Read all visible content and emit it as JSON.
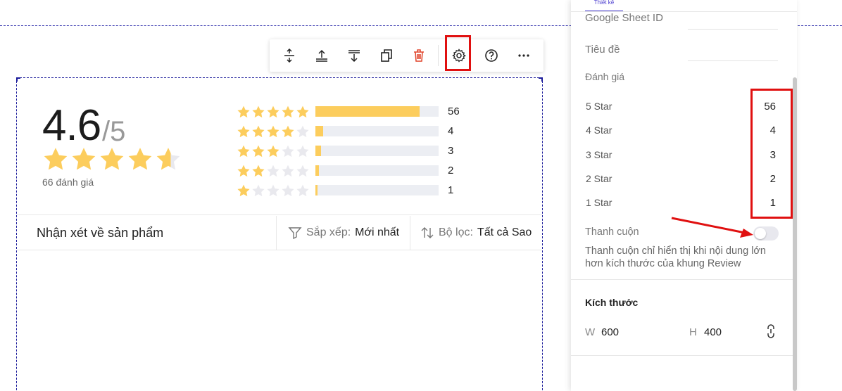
{
  "toolbar": {
    "buttons": [
      {
        "name": "insert-space-icon",
        "title": "Insert space"
      },
      {
        "name": "move-up-icon",
        "title": "Move up"
      },
      {
        "name": "move-down-icon",
        "title": "Move down"
      },
      {
        "name": "duplicate-icon",
        "title": "Duplicate"
      },
      {
        "name": "trash-icon",
        "title": "Delete"
      },
      {
        "name": "gear-icon",
        "title": "Settings"
      },
      {
        "name": "help-icon",
        "title": "Help"
      },
      {
        "name": "more-icon",
        "title": "More"
      }
    ]
  },
  "widget": {
    "score": "4.6",
    "score_max": "/5",
    "score_fraction": 0.92,
    "review_count_label": "66 đánh giá",
    "rows": [
      {
        "stars": 5,
        "fill": 0.848,
        "count": "56"
      },
      {
        "stars": 4,
        "fill": 0.06,
        "count": "4"
      },
      {
        "stars": 3,
        "fill": 0.045,
        "count": "3"
      },
      {
        "stars": 2,
        "fill": 0.03,
        "count": "2"
      },
      {
        "stars": 1,
        "fill": 0.015,
        "count": "1"
      }
    ],
    "reviews_title": "Nhận xét về sản phẩm",
    "sort_label": "Sắp xếp:",
    "sort_value": "Mới nhất",
    "filter_label": "Bộ lọc:",
    "filter_value": "Tất cả Sao"
  },
  "panel": {
    "tab_label": "Thiết kế",
    "google_sheet_label": "Google Sheet ID",
    "title_label": "Tiêu đề",
    "rating_label": "Đánh giá",
    "star_rows": [
      {
        "label": "5 Star",
        "value": "56"
      },
      {
        "label": "4 Star",
        "value": "4"
      },
      {
        "label": "3 Star",
        "value": "3"
      },
      {
        "label": "2 Star",
        "value": "2"
      },
      {
        "label": "1 Star",
        "value": "1"
      }
    ],
    "scroll_label": "Thanh cuộn",
    "scroll_enabled": false,
    "scroll_hint": "Thanh cuộn chỉ hiển thị khi nội dung lớn hơn kích thước của khung Review",
    "size_title": "Kích thước",
    "width_label": "W",
    "width_value": "600",
    "height_label": "H",
    "height_value": "400"
  },
  "colors": {
    "star": "#fccd5d",
    "star_empty": "#e9e9ee",
    "highlight": "#e01010",
    "accent": "#3b30c9"
  }
}
